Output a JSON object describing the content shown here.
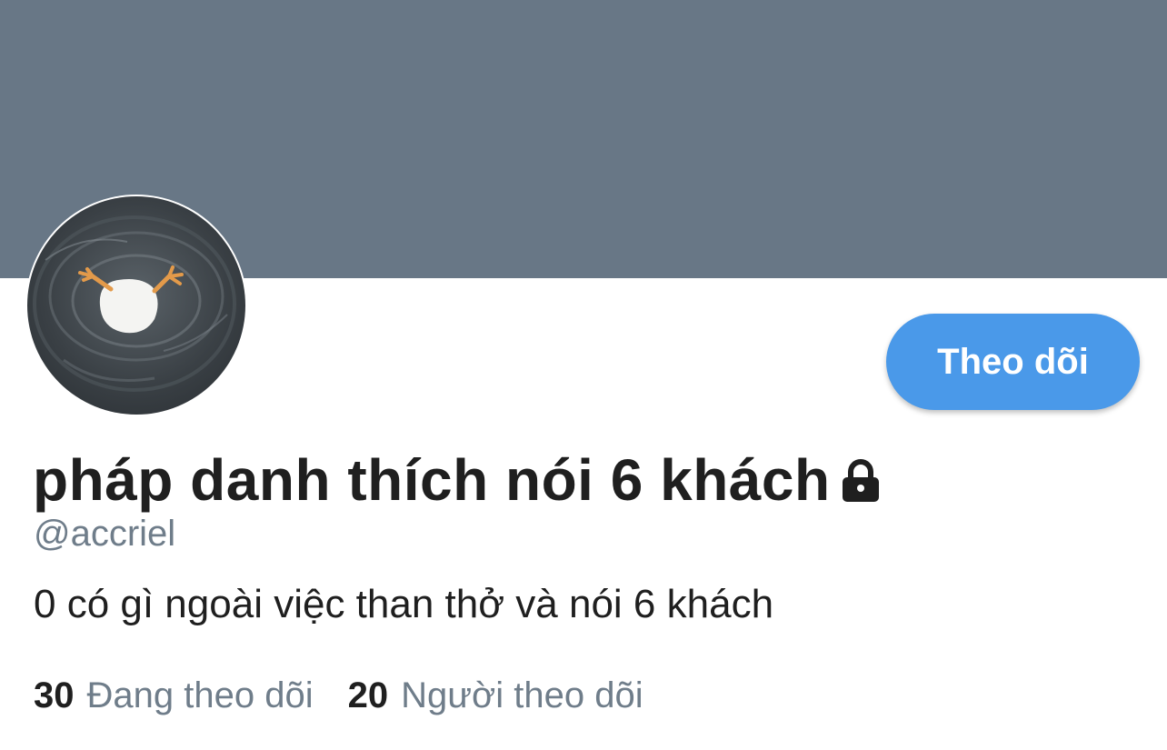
{
  "profile": {
    "display_name": "pháp danh thích nói 6 khách",
    "handle": "@accriel",
    "bio": "0 có gì ngoài việc than thở và nói 6 khách",
    "follow_button_label": "Theo dõi",
    "protected": true,
    "lock_icon": "lock-icon",
    "banner_color": "#687786",
    "accent_color": "#4a99e9"
  },
  "stats": {
    "following_count": "30",
    "following_label": "Đang theo dõi",
    "followers_count": "20",
    "followers_label": "Người theo dõi"
  }
}
